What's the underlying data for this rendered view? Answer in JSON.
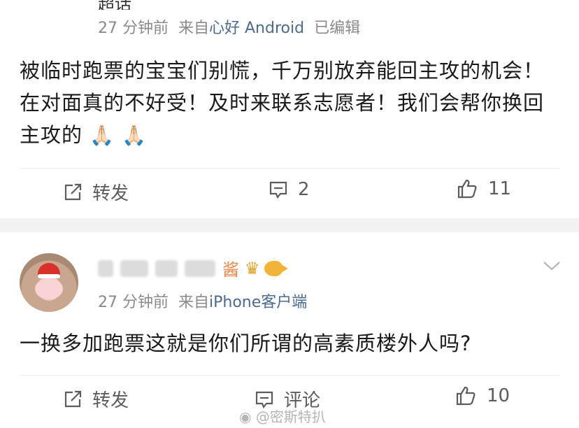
{
  "posts": [
    {
      "username_partial": "超话",
      "time": "27 分钟前",
      "source_prefix": "来自",
      "source_name": "心好 Android",
      "edited": "已编辑",
      "content": "被临时跑票的宝宝们别慌，千万别放弃能回主攻的机会！在对面真的不好受！及时来联系志愿者！我们会帮你换回主攻的",
      "content_emoji": "🙏🏻 🙏🏻",
      "actions": {
        "repost": "转发",
        "comment": "2",
        "like": "11"
      }
    },
    {
      "username_suffix": "酱",
      "time": "27 分钟前",
      "source_prefix": "来自",
      "source_name": "iPhone客户端",
      "content": "一换多加跑票这就是你们所谓的高素质楼外人吗?",
      "actions": {
        "repost": "转发",
        "comment": "评论",
        "like": "10"
      }
    }
  ],
  "watermark": "@密斯特扒",
  "colors": {
    "link": "#4d6a8f",
    "meta": "#8a8a8a",
    "separator": "#f2f2f2"
  },
  "icons": [
    "repost-icon",
    "comment-icon",
    "like-icon",
    "chevron-down-icon",
    "crown-icon",
    "fish-icon",
    "weibo-icon"
  ]
}
